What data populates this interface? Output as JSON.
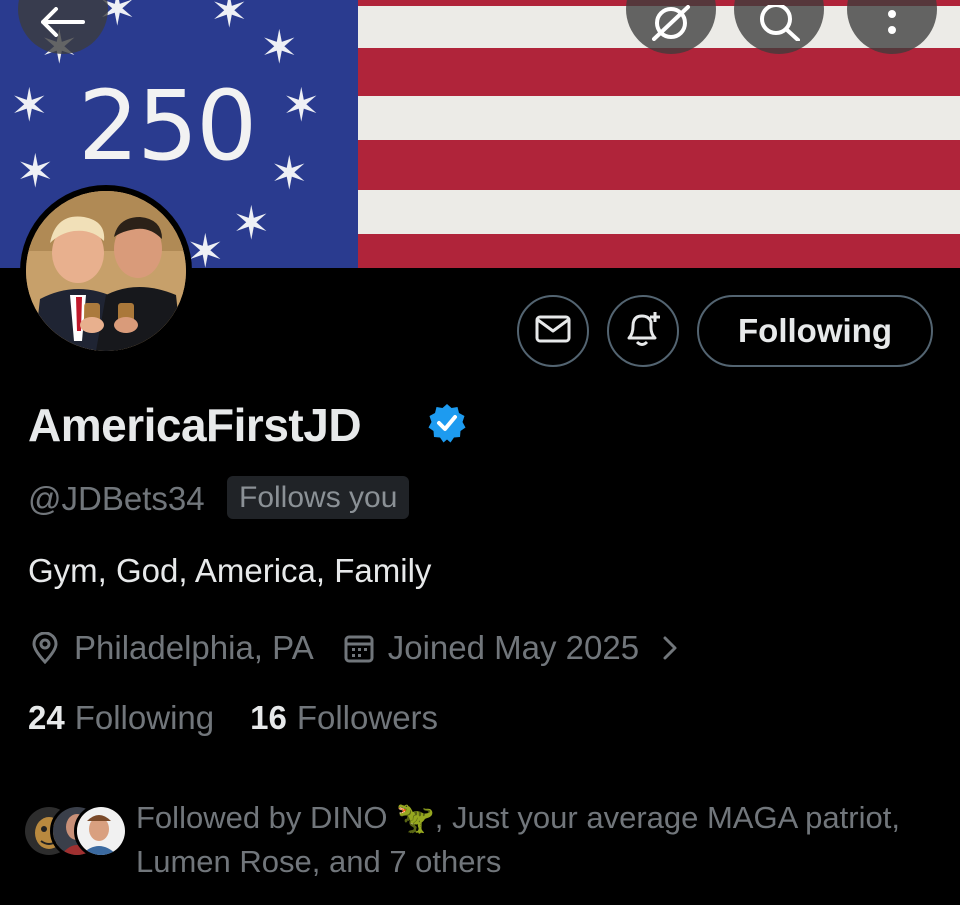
{
  "banner": {
    "number": "250"
  },
  "top_bar": {
    "back_icon": "arrow-left-icon",
    "grok_icon": "grok-icon",
    "search_icon": "search-icon",
    "more_icon": "more-vertical-icon"
  },
  "profile": {
    "display_name": "AmericaFirstJD",
    "handle": "@JDBets34",
    "follows_you": "Follows you",
    "bio": "Gym, God, America, Family",
    "location": "Philadelphia, PA",
    "joined": "Joined May 2025",
    "following_count": "24",
    "following_label": "Following",
    "followers_count": "16",
    "followers_label": "Followers"
  },
  "actions": {
    "message_icon": "mail-icon",
    "notify_icon": "bell-plus-icon",
    "following_button": "Following"
  },
  "followed_by": {
    "text_line1": "Followed by DINO 🦖, Just your average MAGA patriot,",
    "text_line2": "Lumen Rose, and 7 others"
  },
  "colors": {
    "background": "#000000",
    "text": "#e7e9ea",
    "muted": "#71767b",
    "verified": "#1d9bf0",
    "border": "#536471"
  }
}
